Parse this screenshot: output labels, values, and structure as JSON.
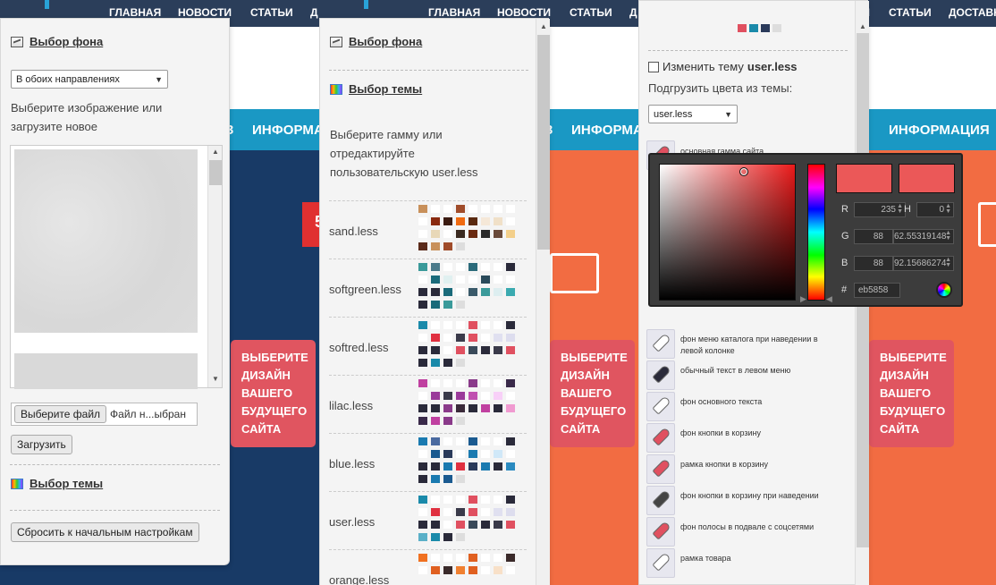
{
  "nav": {
    "home": "ГЛАВНАЯ",
    "news": "НОВОСТИ",
    "articles": "СТАТЬИ",
    "d_cut": "Д",
    "delivery": "ДОСТАВКА"
  },
  "infobar": {
    "label": "ИНФОРМАЦИЯ",
    "mid_cut": "ИНФОРМАЦ",
    "left_cut": "З",
    "banner_cut": "5"
  },
  "design_button": {
    "line1": "ВЫБЕРИТЕ",
    "line2": "ДИЗАЙН",
    "line3": "ВАШЕГО",
    "line4": "БУДУЩЕГО",
    "line5": "САЙТА"
  },
  "panel1": {
    "bg_title": "Выбор фона",
    "direction_select": "В обоих направлениях",
    "hint": "Выберите изображение или загрузите новое",
    "file_button": "Выберите файл",
    "file_status": "Файл н...ыбран",
    "upload_button": "Загрузить",
    "theme_title": "Выбор темы",
    "reset_button": "Сбросить к начальным настройкам"
  },
  "panel2": {
    "bg_title": "Выбор фона",
    "theme_title": "Выбор темы",
    "hint": "Выберите гамму или отредактируйте пользовательскую user.less",
    "themes": [
      {
        "name": "sand.less",
        "colors": [
          [
            "#c8905a",
            "#fff",
            "#fff",
            "#a04c2a",
            "#fff",
            "#fff",
            "#fff",
            "#fff"
          ],
          [
            "#fff",
            "#8a2a10",
            "#3a1a10",
            "#f06a10",
            "#5a2a10",
            "#f5e8d8",
            "#f0e0c8",
            "#fff"
          ],
          [
            "#fff",
            "#e8d8b8",
            "#fff",
            "#3a2a20",
            "#6a2a10",
            "#2a2a2a",
            "#6a4a3a",
            "#f3cf8a"
          ],
          [
            "#5a2a1a",
            "#c8905a",
            "#a04c2a",
            "#ddd"
          ]
        ]
      },
      {
        "name": "softgreen.less",
        "colors": [
          [
            "#3a9a9a",
            "#4a7a8a",
            "#fff",
            "#fff",
            "#2a6a7a",
            "#fff",
            "#fff",
            "#2a2a3a"
          ],
          [
            "#fff",
            "#1a6a7a",
            "#e0f0f0",
            "#fff",
            "#fff",
            "#2a4a5a",
            "#fff",
            "#fff"
          ],
          [
            "#2a2a3a",
            "#2a2a3a",
            "#1a6a7a",
            "#fff",
            "#3a5a6a",
            "#3a9a9a",
            "#ddeef0",
            "#3aaab0"
          ],
          [
            "#2a2a3a",
            "#1a6a7a",
            "#3a9a9a",
            "#ddd"
          ]
        ]
      },
      {
        "name": "softred.less",
        "colors": [
          [
            "#1a8aaa",
            "#fff",
            "#fff",
            "#fff",
            "#e05060",
            "#fff",
            "#fff",
            "#2a2a3a"
          ],
          [
            "#fff",
            "#e03040",
            "#fff",
            "#3a3a4a",
            "#e05060",
            "#fff",
            "#e0e0f0",
            "#dde"
          ],
          [
            "#2a2a3a",
            "#2a2a3a",
            "#fff",
            "#e05060",
            "#3a4a5a",
            "#2a2a3a",
            "#3a3a4a",
            "#e05060"
          ],
          [
            "#2a2a3a",
            "#1a8aaa",
            "#2a2a3a",
            "#ddd"
          ]
        ]
      },
      {
        "name": "lilac.less",
        "colors": [
          [
            "#c040a0",
            "#fff",
            "#fff",
            "#fff",
            "#8a3a8a",
            "#fff",
            "#fff",
            "#3a2a4a"
          ],
          [
            "#fff",
            "#9a3a9a",
            "#3a3a4a",
            "#9a3a9a",
            "#c050b0",
            "#fff",
            "#f8d0f8",
            "#fff"
          ],
          [
            "#2a2a3a",
            "#2a2a3a",
            "#8a3a8a",
            "#3a2a3a",
            "#2a2a3a",
            "#c040a0",
            "#2a2a3a",
            "#f09ad0"
          ],
          [
            "#3a2a4a",
            "#c040a0",
            "#8a3a8a",
            "#ddd"
          ]
        ]
      },
      {
        "name": "blue.less",
        "colors": [
          [
            "#1a7ab0",
            "#4a6aa0",
            "#fff",
            "#fff",
            "#1a5a90",
            "#fff",
            "#fff",
            "#2a2a3a"
          ],
          [
            "#fff",
            "#1a5a90",
            "#2a3a5a",
            "#fff",
            "#1a7ab0",
            "#fff",
            "#d0e8f8",
            "#fff"
          ],
          [
            "#2a2a3a",
            "#2a2a3a",
            "#1a7ab0",
            "#e03040",
            "#2a3a5a",
            "#1a7ab0",
            "#2a2a3a",
            "#2a8ac0"
          ],
          [
            "#2a2a3a",
            "#1a7ab0",
            "#1a5a90",
            "#ddd"
          ]
        ]
      },
      {
        "name": "user.less",
        "colors": [
          [
            "#1a8aaa",
            "#fff",
            "#fff",
            "#fff",
            "#e05060",
            "#fff",
            "#fff",
            "#2a2a3a"
          ],
          [
            "#fff",
            "#e03040",
            "#fff",
            "#3a3a4a",
            "#e05060",
            "#fff",
            "#e0e0f0",
            "#dde"
          ],
          [
            "#2a2a3a",
            "#2a2a3a",
            "#fff",
            "#e05060",
            "#3a4a5a",
            "#2a2a3a",
            "#3a3a4a",
            "#e05060"
          ],
          [
            "#5ab0c8",
            "#1a8aaa",
            "#2a2a3a",
            "#ddd"
          ]
        ]
      },
      {
        "name": "orange.less",
        "colors": [
          [
            "#f07020",
            "#fff",
            "#fff",
            "#fff",
            "#e06020",
            "#fff",
            "#fff",
            "#3a2a2a"
          ],
          [
            "#fff",
            "#e06020",
            "#3a2a2a",
            "#f08030",
            "#e06020",
            "#fff",
            "#f8e0c8",
            "#fff"
          ]
        ]
      }
    ]
  },
  "panel3": {
    "top_swatches": [
      "#e05060",
      "#1a8aaa",
      "#2a3a5a",
      "#ddd"
    ],
    "change_theme_label": "Изменить тему",
    "change_theme_file": "user.less",
    "load_colors_label": "Подгрузить цвета из темы:",
    "theme_select": "user.less",
    "first_item": "основная гамма сайта",
    "picker": {
      "r": "235",
      "g": "88",
      "b": "88",
      "h": "0",
      "s": "62.55319148",
      "v": "92.15686274",
      "hex": "eb5858"
    },
    "items": [
      {
        "label": "фон меню каталога при наведении в левой колонке",
        "color": "#fff"
      },
      {
        "label": "обычный текст в левом меню",
        "color": "#2a2a3a"
      },
      {
        "label": "фон основного текста",
        "color": "#fff"
      },
      {
        "label": "фон кнопки в корзину",
        "color": "#e05060"
      },
      {
        "label": "рамка кнопки в корзину",
        "color": "#e05060"
      },
      {
        "label": "фон кнопки в корзину при наведении",
        "color": "#444"
      },
      {
        "label": "фон полосы в подвале с соцсетями",
        "color": "#e05060"
      },
      {
        "label": "рамка товара",
        "color": "#fff"
      }
    ]
  }
}
